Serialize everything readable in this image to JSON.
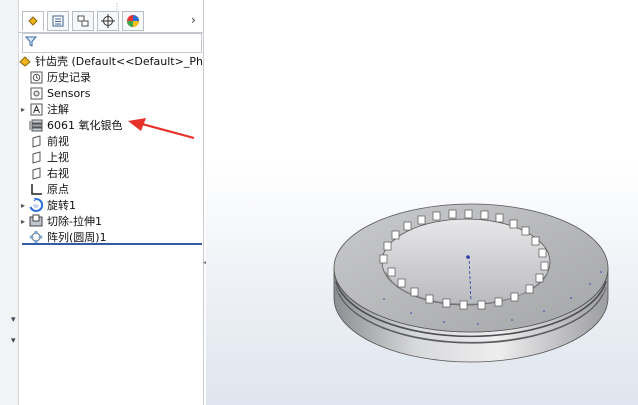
{
  "tree": {
    "root_label": "针齿壳  (Default<<Default>_Photo",
    "items": [
      {
        "label": "历史记录",
        "icon": "history-icon"
      },
      {
        "label": "Sensors",
        "icon": "sensors-icon"
      },
      {
        "label": "注解",
        "icon": "annotations-icon"
      },
      {
        "label": "6061 氧化银色",
        "icon": "material-icon"
      },
      {
        "label": "前视",
        "icon": "plane-icon"
      },
      {
        "label": "上视",
        "icon": "plane-icon"
      },
      {
        "label": "右视",
        "icon": "plane-icon"
      },
      {
        "label": "原点",
        "icon": "origin-icon"
      },
      {
        "label": "旋转1",
        "icon": "revolve-icon"
      },
      {
        "label": "切除-拉伸1",
        "icon": "cut-extrude-icon"
      },
      {
        "label": "阵列(圆周)1",
        "icon": "circular-pattern-icon"
      }
    ]
  },
  "tabs": [
    "feature-manager",
    "property-manager",
    "configuration-manager",
    "dimxpert-manager",
    "display-manager"
  ],
  "accent_color": "#e8302a",
  "selection_color": "#2f5da3"
}
